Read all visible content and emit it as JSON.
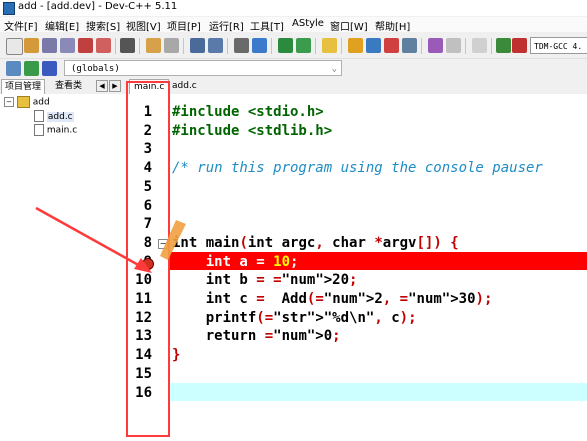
{
  "window": {
    "title": "add - [add.dev] - Dev-C++ 5.11"
  },
  "menu": [
    "文件[F]",
    "编辑[E]",
    "搜索[S]",
    "视图[V]",
    "项目[P]",
    "运行[R]",
    "工具[T]",
    "AStyle",
    "窗口[W]",
    "帮助[H]"
  ],
  "toolbar": {
    "compiler": "TDM-GCC 4."
  },
  "scope_combo": {
    "value": "(globals)"
  },
  "left_panel": {
    "tabs": [
      "项目管理",
      "查看类"
    ],
    "tree": {
      "project": "add",
      "files": [
        "add.c",
        "main.c"
      ]
    }
  },
  "editor": {
    "tabs": [
      "main.c",
      "add.c"
    ],
    "line_numbers": [
      "1",
      "2",
      "3",
      "4",
      "5",
      "6",
      "7",
      "8",
      "9",
      "10",
      "11",
      "12",
      "13",
      "14",
      "15",
      "16"
    ],
    "lines": [
      "#include <stdio.h>",
      "#include <stdlib.h>",
      "",
      "/* run this program using the console pauser",
      "",
      "",
      "",
      "int main(int argc, char *argv[]) {",
      "    int a = 10;",
      "    int b = 20;",
      "    int c =  Add(2, 30);",
      "    printf(\"%d\\n\", c);",
      "    return 0;",
      "}",
      "",
      ""
    ],
    "breakpoint_line": 9,
    "current_line": 16
  },
  "colors": {
    "breakpoint": "#ff0000",
    "current_line": "#ccffff",
    "annotation": "#ff3a3a"
  }
}
